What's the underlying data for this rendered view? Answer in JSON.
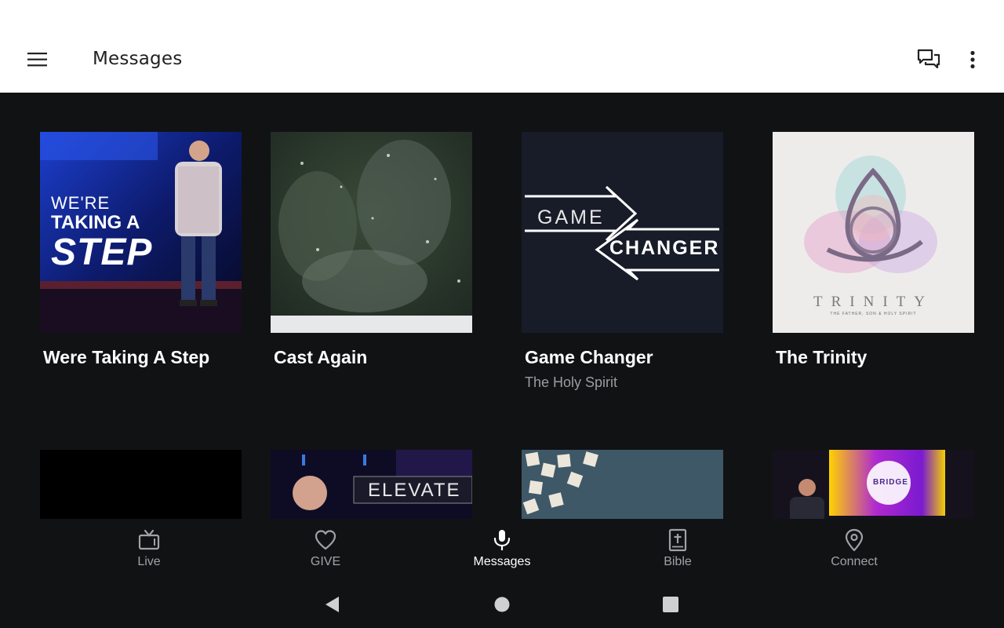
{
  "app_bar": {
    "title": "Messages",
    "menu_icon": "hamburger-menu-icon",
    "chat_icon": "chat-bubbles-icon",
    "more_icon": "more-vertical-icon",
    "background": "#ffffff"
  },
  "messages": [
    {
      "title": "Were Taking A Step",
      "subtitle": "",
      "thumb_text_1": "WE'RE",
      "thumb_text_2": "TAKING A",
      "thumb_text_3": "STEP"
    },
    {
      "title": "Cast Again",
      "subtitle": ""
    },
    {
      "title": "Game Changer",
      "subtitle": "The Holy Spirit",
      "thumb_text_1": "GAME",
      "thumb_text_2": "CHANGER"
    },
    {
      "title": "The Trinity",
      "subtitle": "",
      "thumb_text_1": "TRINITY",
      "thumb_text_2": "THE FATHER, SON & HOLY SPIRIT"
    },
    {
      "title": "",
      "subtitle": ""
    },
    {
      "title": "",
      "subtitle": "",
      "thumb_text_1": "ELEVATE"
    },
    {
      "title": "",
      "subtitle": ""
    },
    {
      "title": "",
      "subtitle": "",
      "thumb_text_1": "BRIDGE"
    }
  ],
  "bottom_nav": {
    "items": [
      {
        "label": "Live",
        "icon": "tv-icon",
        "active": false
      },
      {
        "label": "GIVE",
        "icon": "heart-icon",
        "active": false
      },
      {
        "label": "Messages",
        "icon": "microphone-icon",
        "active": true
      },
      {
        "label": "Bible",
        "icon": "bible-icon",
        "active": false
      },
      {
        "label": "Connect",
        "icon": "location-pin-icon",
        "active": false
      }
    ],
    "active_color": "#ffffff",
    "inactive_color": "#a0a2a6"
  },
  "system_nav": {
    "back_icon": "back-triangle-icon",
    "home_icon": "home-circle-icon",
    "recents_icon": "recents-square-icon"
  }
}
